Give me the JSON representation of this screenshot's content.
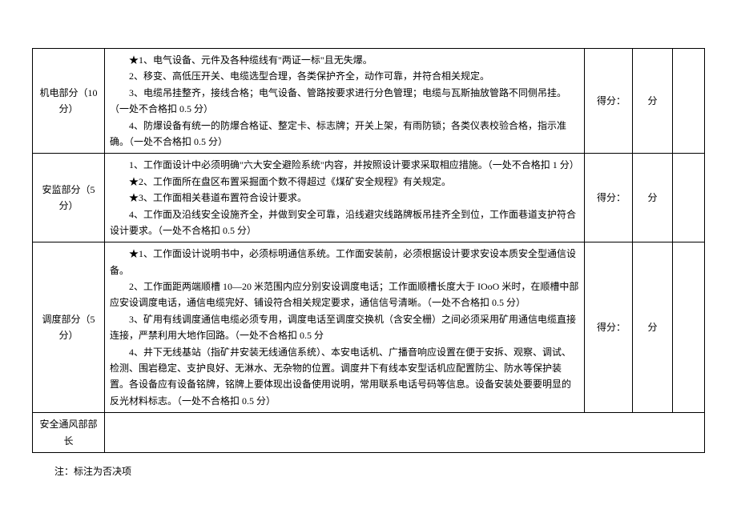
{
  "rows": [
    {
      "label": "机电部分（10分）",
      "items": [
        "★1、电气设备、元件及各种缆线有\"两证一标\"且无失爆。",
        "2、移变、高低压开关、电缆选型合理，各类保护齐全，动作可靠，并符合相关规定。",
        "3、电缆吊挂整齐，接线合格；电气设备、管路按要求进行分色管理；电缆与瓦斯抽放管路不同侧吊挂。（一处不合格扣 0.5 分）",
        "4、防爆设备有统一的防爆合格证、整定卡、标志牌；开关上架，有雨防锁；各类仪表校验合格，指示准确。（一处不合格扣 0.5 分）"
      ],
      "score_label": "得分：",
      "fen": "分"
    },
    {
      "label": "安监部分（5分）",
      "items": [
        "1、工作面设计中必须明确\"六大安全避险系统\"内容，并按照设计要求采取相应措施。（一处不合格扣 1 分）",
        "★2、工作面所在盘区布置采掘面个数不得超过《煤矿安全规程》有关规定。",
        "★3、工作面相关巷道布置符合设计要求。",
        "4、工作面及沿线安全设施齐全，并做到安全可靠，沿线避灾线路牌板吊挂齐全到位，工作面巷道支护符合设计要求。（一处不合格扣 0.5 分）"
      ],
      "score_label": "得分：",
      "fen": "分"
    },
    {
      "label": "调度部分（5分）",
      "items": [
        "★1、工作面设计说明书中，必须标明通信系统。工作面安装前，必须根据设计要求安设本质安全型通信设备。",
        "2、工作面距两端顺槽 10—20 米范围内应分别安设调度电话；工作面顺槽长度大于 IOoO 米时，在顺槽中部应安设调度电话，通信电缆完好、铺设符合相关规定要求，通信信号清晰。（一处不合格扣 0.5 分）",
        "3、矿用有线调度通信电缆必须专用，调度电话至调度交换机（含安全栅）之间必须采用矿用通信电缆直接连接，严禁利用大地作回路。（一处不合格扣 0.5 分",
        "4、井下无线基站（指矿井安装无线通信系统）、本安电话机、广播音响应设置在便于安拆、观察、调试、检测、围岩稳定、支护良好、无淋水、无杂物的位置。调度井下有线本安型话机应配置防尘、防水等保护装置。各设备应有设备铭牌，铭牌上要体现出设备使用说明，常用联系电话号码等信息。设备安装处要要明显的反光材料标志。（一处不合格扣 0.5 分）"
      ],
      "score_label": "得分：",
      "fen": "分"
    },
    {
      "label": "安全通风部部长",
      "items": [],
      "score_label": "",
      "fen": ""
    }
  ],
  "footnote": "注：标注为否决项"
}
